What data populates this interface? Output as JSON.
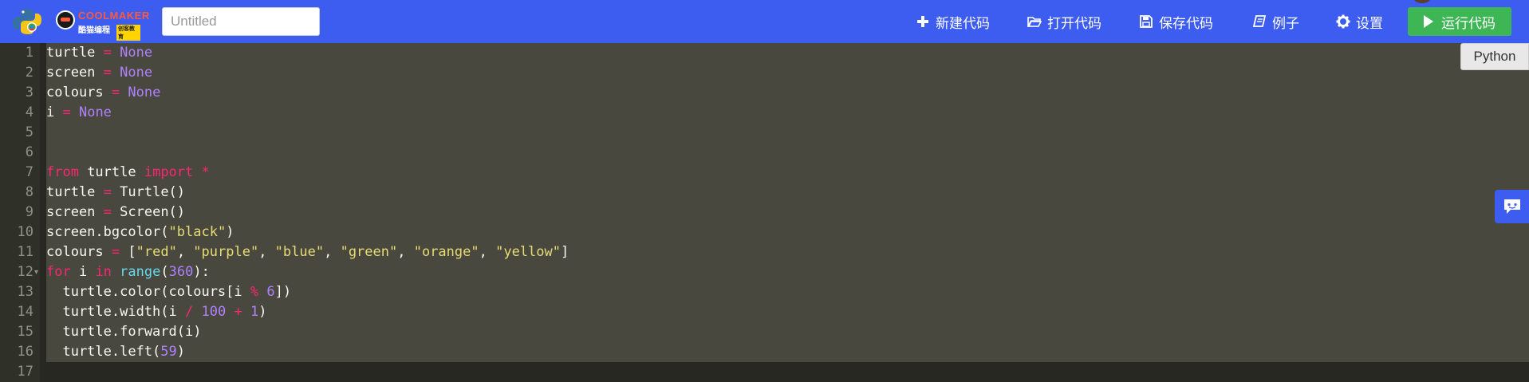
{
  "header": {
    "logo_text_main": "COOLMAKER",
    "logo_text_sub": "酷猫编程",
    "logo_text_tag": "创客教育",
    "title_placeholder": "Untitled",
    "title_value": "",
    "nav": [
      {
        "label": "新建代码",
        "icon": "plus-icon"
      },
      {
        "label": "打开代码",
        "icon": "folder-open-icon"
      },
      {
        "label": "保存代码",
        "icon": "save-icon"
      },
      {
        "label": "例子",
        "icon": "book-icon"
      },
      {
        "label": "设置",
        "icon": "gear-icon"
      }
    ],
    "run_label": "运行代码",
    "brand_color": "#3d5cf0",
    "run_color": "#3fb655"
  },
  "editor": {
    "language": "Python",
    "theme": "monokai",
    "lines": [
      [
        {
          "t": "turtle",
          "c": "id"
        },
        {
          "t": " = ",
          "c": "op"
        },
        {
          "t": "None",
          "c": "const"
        }
      ],
      [
        {
          "t": "screen",
          "c": "id"
        },
        {
          "t": " = ",
          "c": "op"
        },
        {
          "t": "None",
          "c": "const"
        }
      ],
      [
        {
          "t": "colours",
          "c": "id"
        },
        {
          "t": " = ",
          "c": "op"
        },
        {
          "t": "None",
          "c": "const"
        }
      ],
      [
        {
          "t": "i",
          "c": "id"
        },
        {
          "t": " = ",
          "c": "op"
        },
        {
          "t": "None",
          "c": "const"
        }
      ],
      [],
      [],
      [
        {
          "t": "from",
          "c": "kw"
        },
        {
          "t": " turtle ",
          "c": "id"
        },
        {
          "t": "import",
          "c": "kw"
        },
        {
          "t": " ",
          "c": "id"
        },
        {
          "t": "*",
          "c": "op"
        }
      ],
      [
        {
          "t": "turtle",
          "c": "id"
        },
        {
          "t": " = ",
          "c": "op"
        },
        {
          "t": "Turtle()",
          "c": "id"
        }
      ],
      [
        {
          "t": "screen",
          "c": "id"
        },
        {
          "t": " = ",
          "c": "op"
        },
        {
          "t": "Screen()",
          "c": "id"
        }
      ],
      [
        {
          "t": "screen.bgcolor(",
          "c": "id"
        },
        {
          "t": "\"black\"",
          "c": "str"
        },
        {
          "t": ")",
          "c": "id"
        }
      ],
      [
        {
          "t": "colours",
          "c": "id"
        },
        {
          "t": " = ",
          "c": "op"
        },
        {
          "t": "[",
          "c": "id"
        },
        {
          "t": "\"red\"",
          "c": "str"
        },
        {
          "t": ", ",
          "c": "id"
        },
        {
          "t": "\"purple\"",
          "c": "str"
        },
        {
          "t": ", ",
          "c": "id"
        },
        {
          "t": "\"blue\"",
          "c": "str"
        },
        {
          "t": ", ",
          "c": "id"
        },
        {
          "t": "\"green\"",
          "c": "str"
        },
        {
          "t": ", ",
          "c": "id"
        },
        {
          "t": "\"orange\"",
          "c": "str"
        },
        {
          "t": ", ",
          "c": "id"
        },
        {
          "t": "\"yellow\"",
          "c": "str"
        },
        {
          "t": "]",
          "c": "id"
        }
      ],
      [
        {
          "t": "for",
          "c": "kw"
        },
        {
          "t": " i ",
          "c": "id"
        },
        {
          "t": "in",
          "c": "kw"
        },
        {
          "t": " ",
          "c": "id"
        },
        {
          "t": "range",
          "c": "fn"
        },
        {
          "t": "(",
          "c": "id"
        },
        {
          "t": "360",
          "c": "num"
        },
        {
          "t": "):",
          "c": "id"
        }
      ],
      [
        {
          "t": "  turtle.color(colours[i ",
          "c": "id"
        },
        {
          "t": "%",
          "c": "op"
        },
        {
          "t": " ",
          "c": "id"
        },
        {
          "t": "6",
          "c": "num"
        },
        {
          "t": "])",
          "c": "id"
        }
      ],
      [
        {
          "t": "  turtle.width(i ",
          "c": "id"
        },
        {
          "t": "/",
          "c": "op"
        },
        {
          "t": " ",
          "c": "id"
        },
        {
          "t": "100",
          "c": "num"
        },
        {
          "t": " ",
          "c": "id"
        },
        {
          "t": "+",
          "c": "op"
        },
        {
          "t": " ",
          "c": "id"
        },
        {
          "t": "1",
          "c": "num"
        },
        {
          "t": ")",
          "c": "id"
        }
      ],
      [
        {
          "t": "  turtle.forward(i)",
          "c": "id"
        }
      ],
      [
        {
          "t": "  turtle.left(",
          "c": "id"
        },
        {
          "t": "59",
          "c": "num"
        },
        {
          "t": ")",
          "c": "id"
        }
      ],
      []
    ],
    "fold_line": 12
  }
}
